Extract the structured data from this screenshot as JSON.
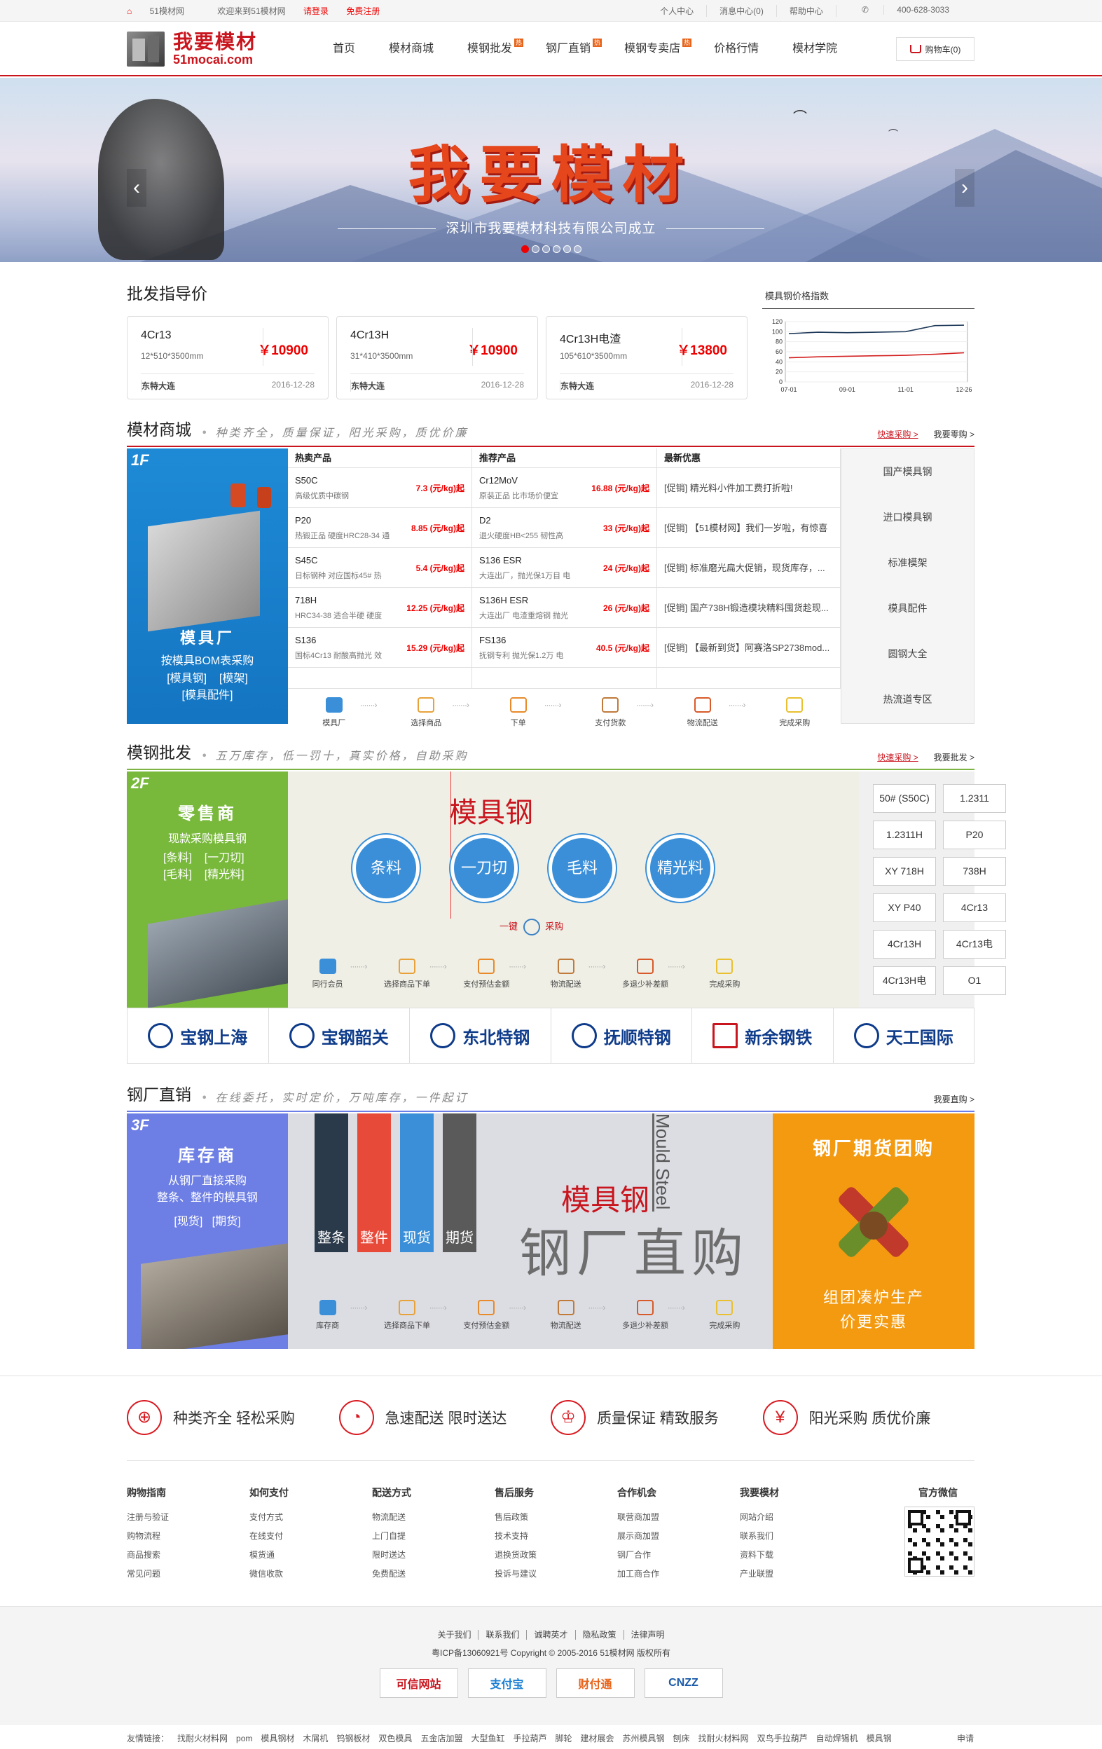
{
  "topbar": {
    "site": "51模材网",
    "welcome": "欢迎来到51模材网",
    "login": "请登录",
    "register": "免费注册",
    "personal": "个人中心",
    "messages": "消息中心(0)",
    "help": "帮助中心",
    "phone": "400-628-3033"
  },
  "logo": {
    "cn": "我要模材",
    "en": "51mocai.com"
  },
  "nav": [
    {
      "label": "首页",
      "hot": ""
    },
    {
      "label": "模材商城",
      "hot": ""
    },
    {
      "label": "模钢批发",
      "hot": "热"
    },
    {
      "label": "钢厂直销",
      "hot": "热"
    },
    {
      "label": "模钢专卖店",
      "hot": "热"
    },
    {
      "label": "价格行情",
      "hot": ""
    },
    {
      "label": "模材学院",
      "hot": ""
    }
  ],
  "cart": {
    "label": "购物车(0)"
  },
  "banner": {
    "title": "我要模材",
    "subtitle": "深圳市我要模材科技有限公司成立",
    "prev": "‹",
    "next": "›"
  },
  "wholesale_guide": {
    "title": "批发指导价",
    "index_title": "模具钢价格指数",
    "cards": [
      {
        "name": "4Cr13",
        "size": "12*510*3500mm",
        "price": "￥10900",
        "brand": "东特大连",
        "date": "2016-12-28"
      },
      {
        "name": "4Cr13H",
        "size": "31*410*3500mm",
        "price": "￥10900",
        "brand": "东特大连",
        "date": "2016-12-28"
      },
      {
        "name": "4Cr13H电渣",
        "size": "105*610*3500mm",
        "price": "￥13800",
        "brand": "东特大连",
        "date": "2016-12-28"
      }
    ]
  },
  "chart_data": {
    "type": "line",
    "title": "模具钢价格指数",
    "categories": [
      "07-01",
      "09-01",
      "11-01",
      "12-26"
    ],
    "ylim": [
      0,
      120
    ],
    "yticks": [
      0,
      20,
      40,
      60,
      80,
      100,
      120
    ],
    "series": [
      {
        "values": [
          96,
          99,
          98,
          99,
          100,
          112,
          113
        ],
        "color": "#1f3a5a"
      },
      {
        "values": [
          48,
          50,
          51,
          52,
          53,
          55,
          58
        ],
        "color": "#d32020"
      }
    ]
  },
  "mall": {
    "title": "模材商城",
    "slogan": "种类齐全，质量保证，阳光采购，质优价廉",
    "quick": "快速采购 >",
    "more": "我要零购 >",
    "floor": "1F",
    "img_title": "模具厂",
    "img_sub": "按模具BOM表采购",
    "img_tags": [
      "[模具钢]",
      "[模架]",
      "[模具配件]"
    ],
    "hot_header": "热卖产品",
    "rec_header": "推荐产品",
    "news_header": "最新优惠",
    "hot": [
      {
        "name": "S50C",
        "desc": "高级优质中碳钢",
        "price": "7.3 (元/kg)起"
      },
      {
        "name": "P20",
        "desc": "热锻正品 硬度HRC28-34 通",
        "price": "8.85 (元/kg)起"
      },
      {
        "name": "S45C",
        "desc": "日标钢种 对应国标45# 热",
        "price": "5.4 (元/kg)起"
      },
      {
        "name": "718H",
        "desc": "HRC34-38 适合半硬 硬度",
        "price": "12.25 (元/kg)起"
      },
      {
        "name": "S136",
        "desc": "国标4Cr13 耐酸高抛光 效",
        "price": "15.29 (元/kg)起"
      }
    ],
    "rec": [
      {
        "name": "Cr12MoV",
        "desc": "原装正品 比市场价便宜",
        "price": "16.88 (元/kg)起"
      },
      {
        "name": "D2",
        "desc": "退火硬度HB<255 韧性高",
        "price": "33 (元/kg)起"
      },
      {
        "name": "S136 ESR",
        "desc": "大连出厂，抛光保1万目 电",
        "price": "24 (元/kg)起"
      },
      {
        "name": "S136H ESR",
        "desc": "大连出厂 电渣重熔钢 抛光",
        "price": "26 (元/kg)起"
      },
      {
        "name": "FS136",
        "desc": "抚钢专利 抛光保1.2万 电",
        "price": "40.5 (元/kg)起"
      }
    ],
    "news": [
      "[促销] 精光料小件加工费打折啦!",
      "[促销] 【51模材网】我们一岁啦，有惊喜",
      "[促销] 标准磨光扁大促销，现货库存，...",
      "[促销] 国产738H锻造模块精料囤货趁现...",
      "[促销] 【最新到货】阿赛洛SP2738mod..."
    ],
    "side": [
      "国产模具钢",
      "进口模具钢",
      "标准模架",
      "模具配件",
      "圆钢大全",
      "热流道专区"
    ],
    "steps": [
      "模具厂",
      "选择商品",
      "下单",
      "支付货款",
      "物流配送",
      "完成采购"
    ]
  },
  "wholesale": {
    "title": "模钢批发",
    "slogan": "五万库存，低一罚十，真实价格，自助采购",
    "quick": "快速采购 >",
    "more": "我要批发 >",
    "floor": "2F",
    "img_title": "零售商",
    "img_sub": "现款采购模具钢",
    "img_tags": [
      "[条料]",
      "[一刀切]",
      "[毛料]",
      "[精光料]"
    ],
    "center_title": "模具钢",
    "circles": [
      "条料",
      "一刀切",
      "毛料",
      "精光料"
    ],
    "buy": "一键",
    "buy2": "采购",
    "steps": [
      "同行会员",
      "选择商品下单",
      "支付预估金额",
      "物流配送",
      "多退少补差额",
      "完成采购"
    ],
    "grades": [
      "50# (S50C)",
      "1.2311",
      "1.2311H",
      "P20",
      "XY 718H",
      "738H",
      "XY P40",
      "4Cr13",
      "4Cr13H",
      "4Cr13电",
      "4Cr13H电",
      "O1"
    ]
  },
  "brands": [
    "宝钢上海",
    "宝钢韶关",
    "东北特钢",
    "抚顺特钢",
    "新余钢铁",
    "天工国际"
  ],
  "direct": {
    "title": "钢厂直销",
    "slogan": "在线委托，实时定价，万吨库存，一件起订",
    "more": "我要直购 >",
    "floor": "3F",
    "img_title": "库存商",
    "img_sub1": "从钢厂直接采购",
    "img_sub2": "整条、整件的模具钢",
    "img_tags": [
      "[现货]",
      "[期货]"
    ],
    "bars": [
      "整条",
      "整件",
      "现货",
      "期货"
    ],
    "big1": "模具钢",
    "big2": "钢厂直购",
    "vertical": "Mould Steel",
    "steps": [
      "库存商",
      "选择商品下单",
      "支付预估金额",
      "物流配送",
      "多退少补差额",
      "完成采购"
    ],
    "promo_title": "钢厂期货团购",
    "promo_line1": "组团凑炉生产",
    "promo_line2": "价更实惠"
  },
  "features": [
    {
      "icon": "globe-icon",
      "text": "种类齐全 轻松采购"
    },
    {
      "icon": "clock-icon",
      "text": "急速配送 限时送达"
    },
    {
      "icon": "trophy-icon",
      "text": "质量保证 精致服务"
    },
    {
      "icon": "yen-icon",
      "text": "阳光采购 质优价廉"
    }
  ],
  "footer_cols": [
    {
      "title": "购物指南",
      "links": [
        "注册与验证",
        "购物流程",
        "商品搜索",
        "常见问题"
      ]
    },
    {
      "title": "如何支付",
      "links": [
        "支付方式",
        "在线支付",
        "模货通",
        "微信收款"
      ]
    },
    {
      "title": "配送方式",
      "links": [
        "物流配送",
        "上门自提",
        "限时送达",
        "免费配送"
      ]
    },
    {
      "title": "售后服务",
      "links": [
        "售后政策",
        "技术支持",
        "退换货政策",
        "投诉与建议"
      ]
    },
    {
      "title": "合作机会",
      "links": [
        "联营商加盟",
        "展示商加盟",
        "钢厂合作",
        "加工商合作"
      ]
    },
    {
      "title": "我要模材",
      "links": [
        "网站介绍",
        "联系我们",
        "资料下载",
        "产业联盟"
      ]
    },
    {
      "title": "官方微信",
      "links": []
    }
  ],
  "bottom_links": [
    "关于我们",
    "联系我们",
    "诚聘英才",
    "隐私政策",
    "法律声明"
  ],
  "icp": "粤ICP备13060921号   Copyright © 2005-2016 51模材网 版权所有",
  "badges": [
    "可信网站",
    "支付宝",
    "财付通",
    "CNZZ"
  ],
  "friend_links": [
    "友情链接：",
    "找耐火材料网",
    "pom",
    "模具钢材",
    "木屑机",
    "钨钢板材",
    "双色模具",
    "五金店加盟",
    "大型鱼缸",
    "手拉葫芦",
    "脚轮",
    "建材展会",
    "苏州模具钢",
    "刨床",
    "找耐火材料网",
    "双鸟手拉葫芦",
    "自动焊锡机",
    "模具钢"
  ],
  "apply": "申请"
}
